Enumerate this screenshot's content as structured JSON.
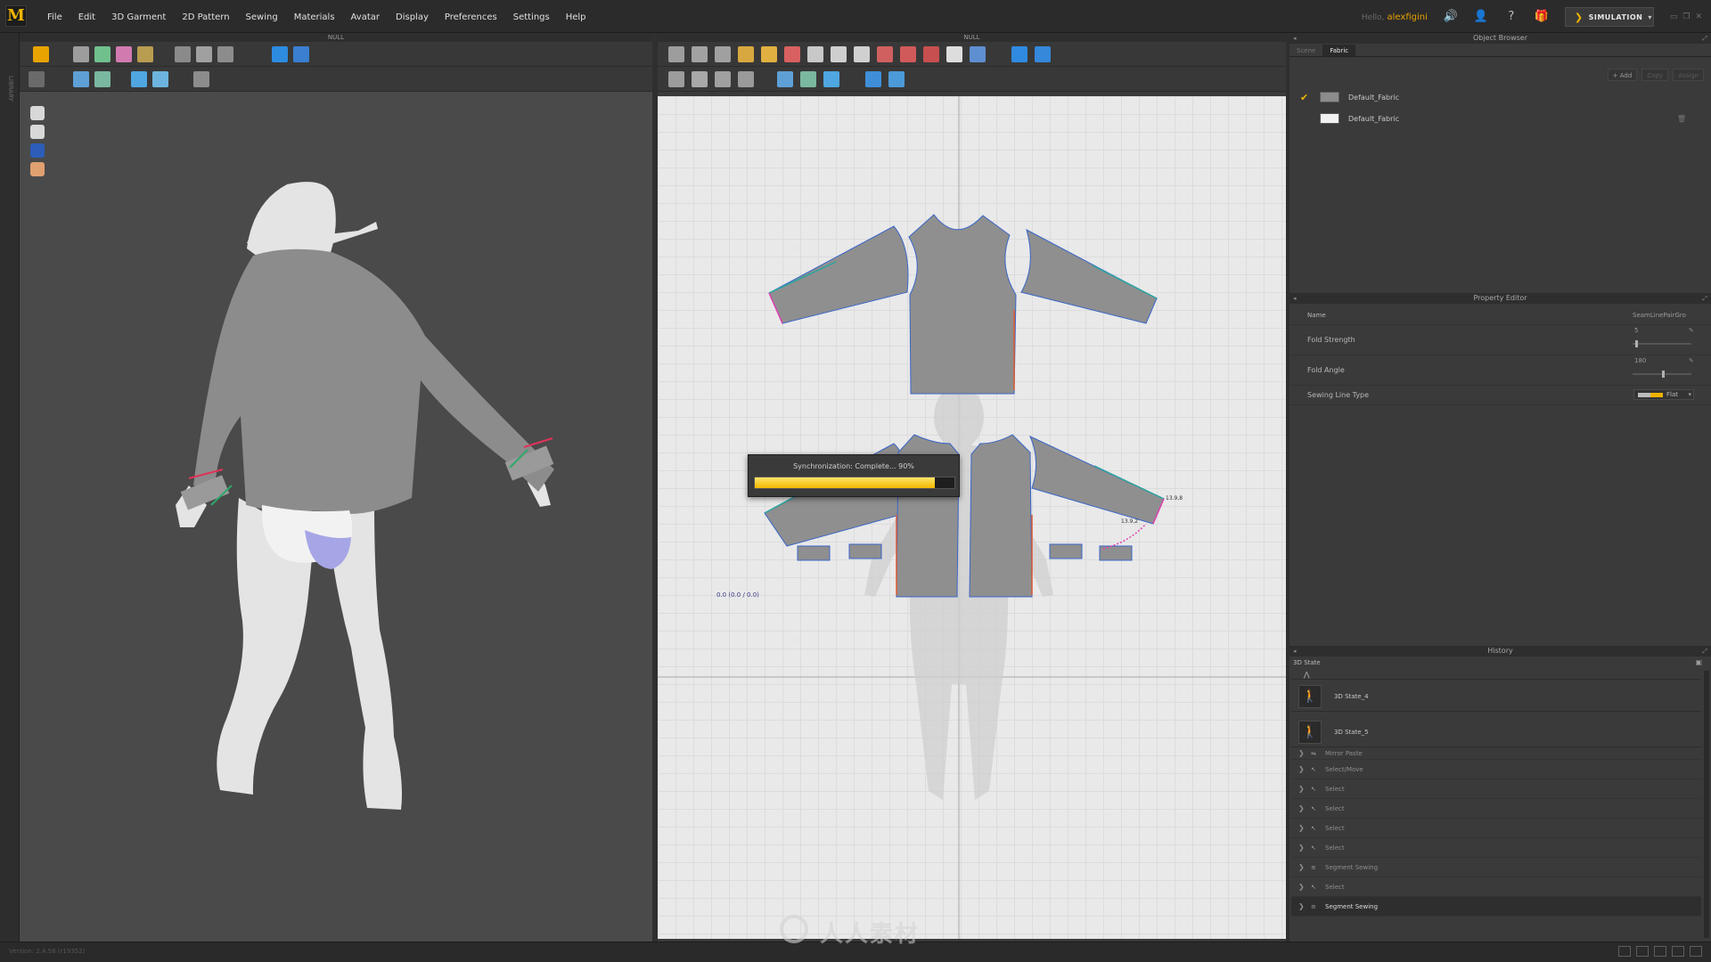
{
  "app": {
    "logo_letter": "M",
    "menus": [
      "File",
      "Edit",
      "3D Garment",
      "2D Pattern",
      "Sewing",
      "Materials",
      "Avatar",
      "Display",
      "Preferences",
      "Settings",
      "Help"
    ],
    "hello_prefix": "Hello,",
    "username": "alexfigini",
    "mode_label": "SIMULATION",
    "accent_color": "#f0b400"
  },
  "left_strip": {
    "label": "LIBRARY"
  },
  "panel3d": {
    "header": "NULL"
  },
  "panel2d": {
    "header": "NULL",
    "sync_text": "Synchronization: Complete... 90%",
    "sync_progress": 0.9,
    "coord_readout": "0.0 (0.0 / 0.0)",
    "measure_1": "13.9,8",
    "measure_2": "13.9,2"
  },
  "object_browser": {
    "title": "Object Browser",
    "tabs": [
      "Scene",
      "Fabric"
    ],
    "active_tab": "Fabric",
    "actions": {
      "add": "+ Add",
      "copy": "Copy",
      "assign": "Assign"
    },
    "fabrics": [
      {
        "name": "Default_Fabric",
        "checked": true,
        "swatch": "#8c8c8c"
      },
      {
        "name": "Default_Fabric",
        "checked": false,
        "swatch": "#f2f2f2"
      }
    ]
  },
  "property_editor": {
    "title": "Property Editor",
    "rows": {
      "name_label": "Name",
      "name_value": "SeamLinePairGro",
      "fold_strength_label": "Fold Strength",
      "fold_strength_value": "5",
      "fold_strength_level": 0.05,
      "fold_angle_label": "Fold Angle",
      "fold_angle_value": "180",
      "fold_angle_level": 0.5,
      "sewing_line_type_label": "Sewing Line Type",
      "sewing_line_type_value": "Flat"
    }
  },
  "history": {
    "title": "History",
    "section": "3D State",
    "states": [
      "3D State_4",
      "3D State_5"
    ],
    "ops": [
      {
        "label": "Mirror Paste",
        "icon": "⇋"
      },
      {
        "label": "Select/Move",
        "icon": "↖"
      },
      {
        "label": "Select",
        "icon": "↖"
      },
      {
        "label": "Select",
        "icon": "↖"
      },
      {
        "label": "Select",
        "icon": "↖"
      },
      {
        "label": "Select",
        "icon": "↖"
      },
      {
        "label": "Segment Sewing",
        "icon": "≡"
      },
      {
        "label": "Select",
        "icon": "↖"
      },
      {
        "label": "Segment Sewing",
        "icon": "≡"
      }
    ]
  },
  "status": {
    "version": "Version: 2.4.58   (r19352)",
    "watermark": "人人素材"
  }
}
